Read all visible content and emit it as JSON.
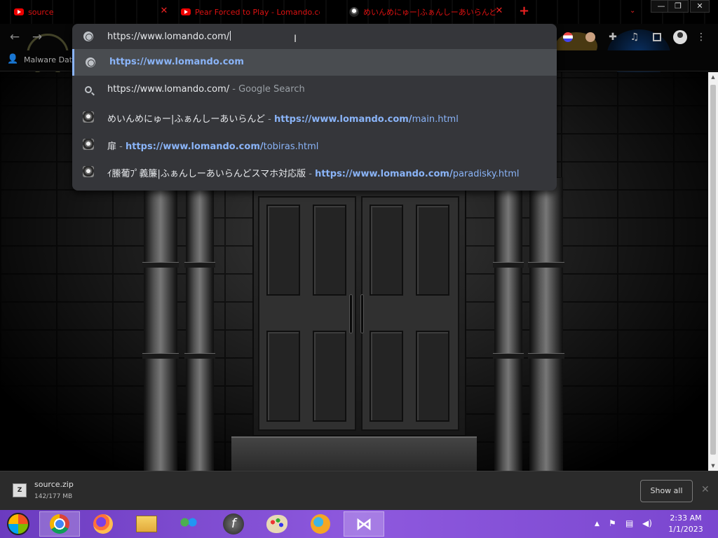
{
  "browser": {
    "tabs": [
      {
        "title": "source",
        "icon": "youtube-red-icon"
      },
      {
        "title": "Pear Forced to Play - Lomando.co",
        "icon": "youtube-icon"
      },
      {
        "title": "めいんめにゅー|ふぁんしーあいらんど",
        "icon": "pixel-character-icon"
      }
    ],
    "new_tab_label": "+",
    "window_controls": [
      "minimize",
      "restore",
      "close"
    ]
  },
  "bookmarks": {
    "items": [
      {
        "label": "Malware Dat",
        "icon": "user-icon"
      }
    ]
  },
  "omnibox": {
    "input_value": "https://www.lomando.com/",
    "suggestions": [
      {
        "icon": "globe-icon",
        "parts": [
          {
            "text": "https://www.lomando.com",
            "style": "blue bold"
          }
        ],
        "selected": true
      },
      {
        "icon": "search-icon",
        "parts": [
          {
            "text": "https://www.lomando.com/",
            "style": "white"
          },
          {
            "text": " - Google Search",
            "style": "grey"
          }
        ],
        "selected": false
      },
      {
        "icon": "pixel-character-icon",
        "parts": [
          {
            "text": "めいんめにゅー|ふぁんしーあいらんど",
            "style": "white"
          },
          {
            "text": " - ",
            "style": "grey"
          },
          {
            "text": "https://www.lomando.com/",
            "style": "blue bold"
          },
          {
            "text": "main.html",
            "style": "blue"
          }
        ],
        "selected": false
      },
      {
        "icon": "pixel-character-icon",
        "parts": [
          {
            "text": "扉",
            "style": "white"
          },
          {
            "text": " - ",
            "style": "grey"
          },
          {
            "text": "https://www.lomando.com/",
            "style": "blue bold"
          },
          {
            "text": "tobiras.html",
            "style": "blue"
          }
        ],
        "selected": false
      },
      {
        "icon": "pixel-character-icon",
        "parts": [
          {
            "text": "ｲ縢葡ﾌﾟ義簾|ふぁんしーあいらんどスマホ対応版",
            "style": "white"
          },
          {
            "text": " - ",
            "style": "grey"
          },
          {
            "text": "https://www.lomando.com/",
            "style": "blue bold"
          },
          {
            "text": "paradisky.html",
            "style": "blue"
          }
        ],
        "selected": false
      }
    ]
  },
  "download": {
    "filename": "source.zip",
    "progress_text": "142/177 MB",
    "progress_fraction": 0.802,
    "show_all_label": "Show all"
  },
  "taskbar": {
    "apps": [
      "start-orb-icon",
      "chrome-icon",
      "firefox-icon",
      "file-explorer-icon",
      "network-users-icon",
      "flash-icon",
      "paint-icon",
      "waterfox-icon",
      "visual-studio-icon"
    ],
    "active_apps": [
      "chrome-icon",
      "visual-studio-icon"
    ],
    "tray_icons": [
      "chevron-up-icon",
      "flag-icon",
      "network-icon",
      "volume-icon"
    ],
    "time": "2:33 AM",
    "date": "1/1/2023"
  },
  "colors": {
    "tab_text": "#dd1111",
    "omnibox_bg": "#35363a",
    "link_blue": "#8ab4f8",
    "taskbar": "#8e59de"
  }
}
